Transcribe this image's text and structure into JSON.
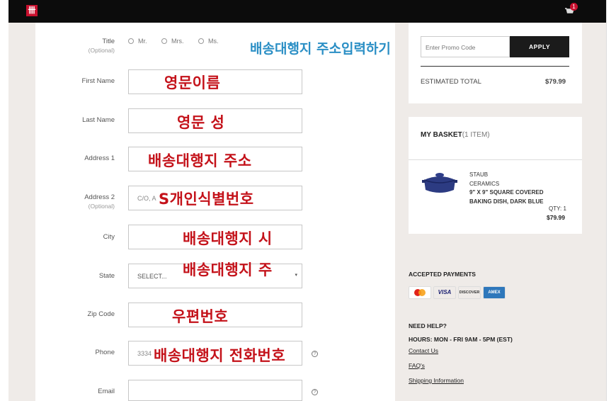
{
  "header": {
    "logo_text": "卌",
    "cart_count": "1",
    "brand_color": "#c8102e"
  },
  "form": {
    "title_label": "Title",
    "title_optional": "(Optional)",
    "title_options": [
      "Mr.",
      "Mrs.",
      "Ms."
    ],
    "first_name_label": "First Name",
    "last_name_label": "Last Name",
    "address1_label": "Address 1",
    "address2_label": "Address 2",
    "address2_optional": "(Optional)",
    "address2_placeholder": "C/O, A",
    "city_label": "City",
    "state_label": "State",
    "state_value": "SELECT...",
    "zip_label": "Zip Code",
    "phone_label": "Phone",
    "phone_placeholder": "3334",
    "email_label": "Email",
    "help_icon_glyph": "?"
  },
  "annotations": {
    "heading": "배송대행지 주소입력하기",
    "first_name": "영문이름",
    "last_name": "영문 성",
    "address1": "배송대행지 주소",
    "address2": "S개인식별번호",
    "city": "배송대행지 시",
    "state": "배송대행지 주",
    "zip": "우편번호",
    "phone": "배송대행지 전화번호",
    "annotation_color": "#c4121a",
    "heading_color": "#2b8fc5"
  },
  "summary": {
    "promo_placeholder": "Enter Promo Code",
    "apply_label": "APPLY",
    "estimated_total_label": "ESTIMATED TOTAL",
    "estimated_total_value": "$79.99"
  },
  "basket": {
    "title": "MY BASKET",
    "count_text": "(1 ITEM)",
    "item": {
      "brand_line1": "STAUB",
      "brand_line2": "CERAMICS",
      "name_line1": "9\" X 9\" SQUARE COVERED",
      "name_line2": "BAKING DISH, DARK BLUE",
      "qty": "QTY: 1",
      "price": "$79.99"
    }
  },
  "payments": {
    "title": "ACCEPTED PAYMENTS",
    "cards": [
      "MasterCard",
      "VISA",
      "DISCOVER",
      "AMEX"
    ]
  },
  "help": {
    "title": "NEED HELP?",
    "hours": "HOURS: MON - FRI 9AM - 5PM (EST)",
    "links": [
      "Contact Us",
      "FAQ's",
      "Shipping Information"
    ]
  }
}
